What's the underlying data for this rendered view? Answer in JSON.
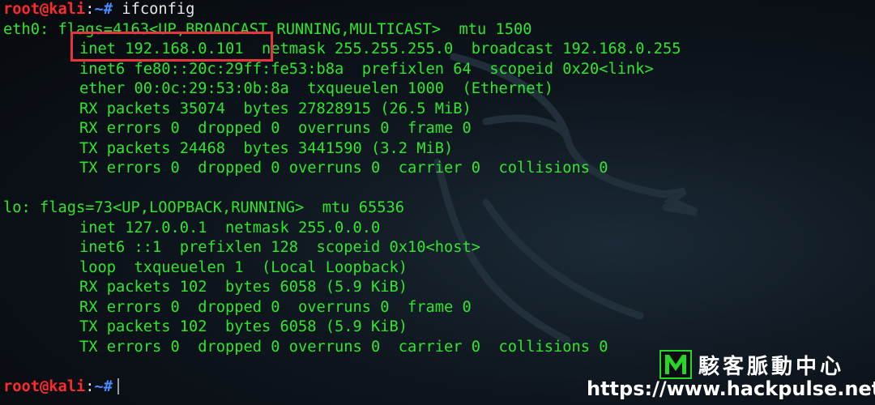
{
  "prompt": {
    "user": "root@kali",
    "sep": ":",
    "path": "~#"
  },
  "command": "ifconfig",
  "eth0": {
    "header": "eth0: flags=4163<UP,BROADCAST,RUNNING,MULTICAST>  mtu 1500",
    "lines": [
      "inet 192.168.0.101  netmask 255.255.255.0  broadcast 192.168.0.255",
      "inet6 fe80::20c:29ff:fe53:b8a  prefixlen 64  scopeid 0x20<link>",
      "ether 00:0c:29:53:0b:8a  txqueuelen 1000  (Ethernet)",
      "RX packets 35074  bytes 27828915 (26.5 MiB)",
      "RX errors 0  dropped 0  overruns 0  frame 0",
      "TX packets 24468  bytes 3441590 (3.2 MiB)",
      "TX errors 0  dropped 0 overruns 0  carrier 0  collisions 0"
    ]
  },
  "lo": {
    "header": "lo: flags=73<UP,LOOPBACK,RUNNING>  mtu 65536",
    "lines": [
      "inet 127.0.0.1  netmask 255.0.0.0",
      "inet6 ::1  prefixlen 128  scopeid 0x10<host>",
      "loop  txqueuelen 1  (Local Loopback)",
      "RX packets 102  bytes 6058 (5.9 KiB)",
      "RX errors 0  dropped 0  overruns 0  frame 0",
      "TX packets 102  bytes 6058 (5.9 KiB)",
      "TX errors 0  dropped 0 overruns 0  carrier 0  collisions 0"
    ]
  },
  "watermark": {
    "logo_letter": "M",
    "name": "駭客脈動中心",
    "url": "https://www.hackpulse.net"
  },
  "colors": {
    "output": "#2ee62e",
    "user": "#ff2a2a",
    "path": "#4a8cff",
    "highlight_box": "#e8343c"
  }
}
